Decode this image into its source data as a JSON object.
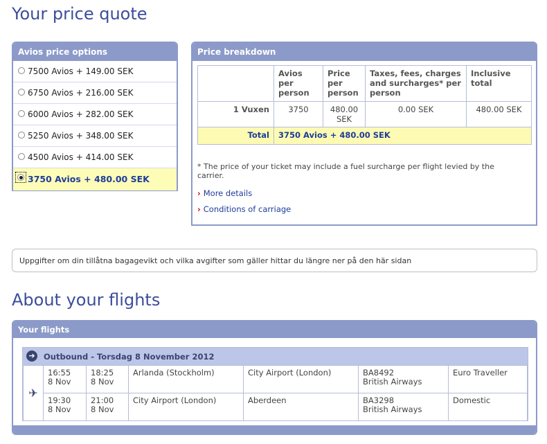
{
  "quote_title": "Your price quote",
  "avios": {
    "heading": "Avios price options",
    "options": [
      {
        "label": "7500 Avios + 149.00 SEK"
      },
      {
        "label": "6750 Avios + 216.00 SEK"
      },
      {
        "label": "6000 Avios + 282.00 SEK"
      },
      {
        "label": "5250 Avios + 348.00 SEK"
      },
      {
        "label": "4500 Avios + 414.00 SEK"
      },
      {
        "label": "3750 Avios + 480.00 SEK"
      }
    ],
    "selected_index": 5
  },
  "breakdown": {
    "heading": "Price breakdown",
    "headers": [
      "Avios per person",
      "Price per person",
      "Taxes, fees, charges and surcharges* per person",
      "Inclusive total"
    ],
    "passenger": {
      "label": "1 Vuxen",
      "avios": "3750",
      "price": "480.00 SEK",
      "taxes": "0.00 SEK",
      "total": "480.00 SEK"
    },
    "total": {
      "label": "Total",
      "value": "3750 Avios + 480.00 SEK"
    },
    "note": "* The price of your ticket may include a fuel surcharge per flight levied by the carrier.",
    "more_details": "More details",
    "conditions": "Conditions of carriage"
  },
  "baggage_notice": "Uppgifter om din tillåtna bagagevikt och vilka avgifter som gäller hittar du längre ner på den här sidan",
  "flights_title": "About your flights",
  "flights": {
    "heading": "Your flights",
    "outbound_title": "Outbound - Torsdag 8 November 2012",
    "legs": [
      {
        "dep_time": "16:55",
        "dep_date": "8 Nov",
        "arr_time": "18:25",
        "arr_date": "8 Nov",
        "from": "Arlanda (Stockholm)",
        "to": "City Airport (London)",
        "flight": "BA8492",
        "airline": "British Airways",
        "cabin": "Euro Traveller"
      },
      {
        "dep_time": "19:30",
        "dep_date": "8 Nov",
        "arr_time": "21:00",
        "arr_date": "8 Nov",
        "from": "City Airport (London)",
        "to": "Aberdeen",
        "flight": "BA3298",
        "airline": "British Airways",
        "cabin": "Domestic"
      }
    ]
  },
  "colors": {
    "accent": "#8c9ac9",
    "title": "#3c4d9b",
    "highlight": "#fdfdb8",
    "link": "#1f3c9a",
    "chevron": "#cc0000"
  },
  "icons": {
    "outbound": "arrow-right-circle-icon",
    "plane": "plane-icon",
    "link": "chevron-right-icon"
  }
}
